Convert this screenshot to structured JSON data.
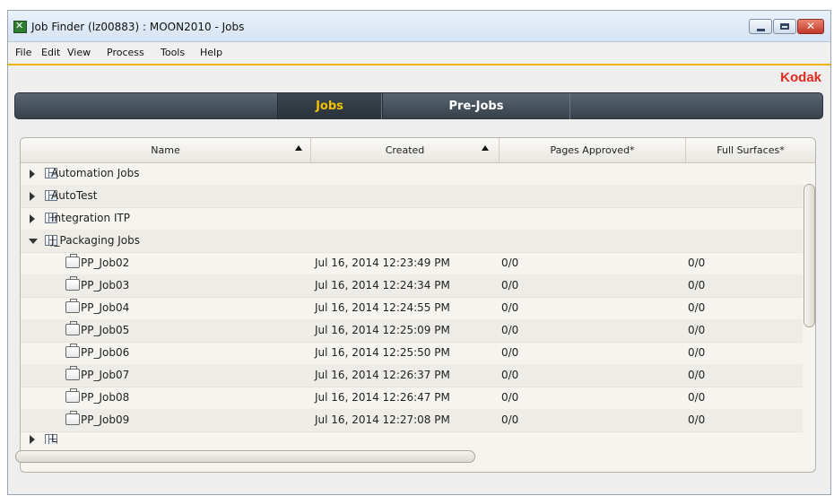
{
  "window": {
    "title": "Job Finder (lz00883) : MOON2010 - Jobs"
  },
  "menu": [
    "File",
    "Edit",
    "View",
    "Process",
    "Tools",
    "Help"
  ],
  "brand": {
    "logo_text": "Kodak"
  },
  "tabs": [
    {
      "label": "Jobs",
      "active": true
    },
    {
      "label": "Pre-Jobs",
      "active": false
    }
  ],
  "table": {
    "columns": [
      "Name",
      "Created",
      "Pages Approved*",
      "Full Surfaces*"
    ],
    "folders": [
      {
        "name": "Automation Jobs",
        "expanded": false
      },
      {
        "name": "AutoTest",
        "expanded": false
      },
      {
        "name": "Integration ITP",
        "expanded": false
      },
      {
        "name": "J_Packaging Jobs",
        "expanded": true
      },
      {
        "name": "L",
        "expanded": false
      }
    ],
    "jobs": [
      {
        "name": "PP_Job02",
        "created": "Jul 16, 2014 12:23:49 PM",
        "pages_approved": "0/0",
        "full_surfaces": "0/0"
      },
      {
        "name": "PP_Job03",
        "created": "Jul 16, 2014 12:24:34 PM",
        "pages_approved": "0/0",
        "full_surfaces": "0/0"
      },
      {
        "name": "PP_Job04",
        "created": "Jul 16, 2014 12:24:55 PM",
        "pages_approved": "0/0",
        "full_surfaces": "0/0"
      },
      {
        "name": "PP_Job05",
        "created": "Jul 16, 2014 12:25:09 PM",
        "pages_approved": "0/0",
        "full_surfaces": "0/0"
      },
      {
        "name": "PP_Job06",
        "created": "Jul 16, 2014 12:25:50 PM",
        "pages_approved": "0/0",
        "full_surfaces": "0/0"
      },
      {
        "name": "PP_Job07",
        "created": "Jul 16, 2014 12:26:37 PM",
        "pages_approved": "0/0",
        "full_surfaces": "0/0"
      },
      {
        "name": "PP_Job08",
        "created": "Jul 16, 2014 12:26:47 PM",
        "pages_approved": "0/0",
        "full_surfaces": "0/0"
      },
      {
        "name": "PP_Job09",
        "created": "Jul 16, 2014 12:27:08 PM",
        "pages_approved": "0/0",
        "full_surfaces": "0/0"
      }
    ]
  }
}
